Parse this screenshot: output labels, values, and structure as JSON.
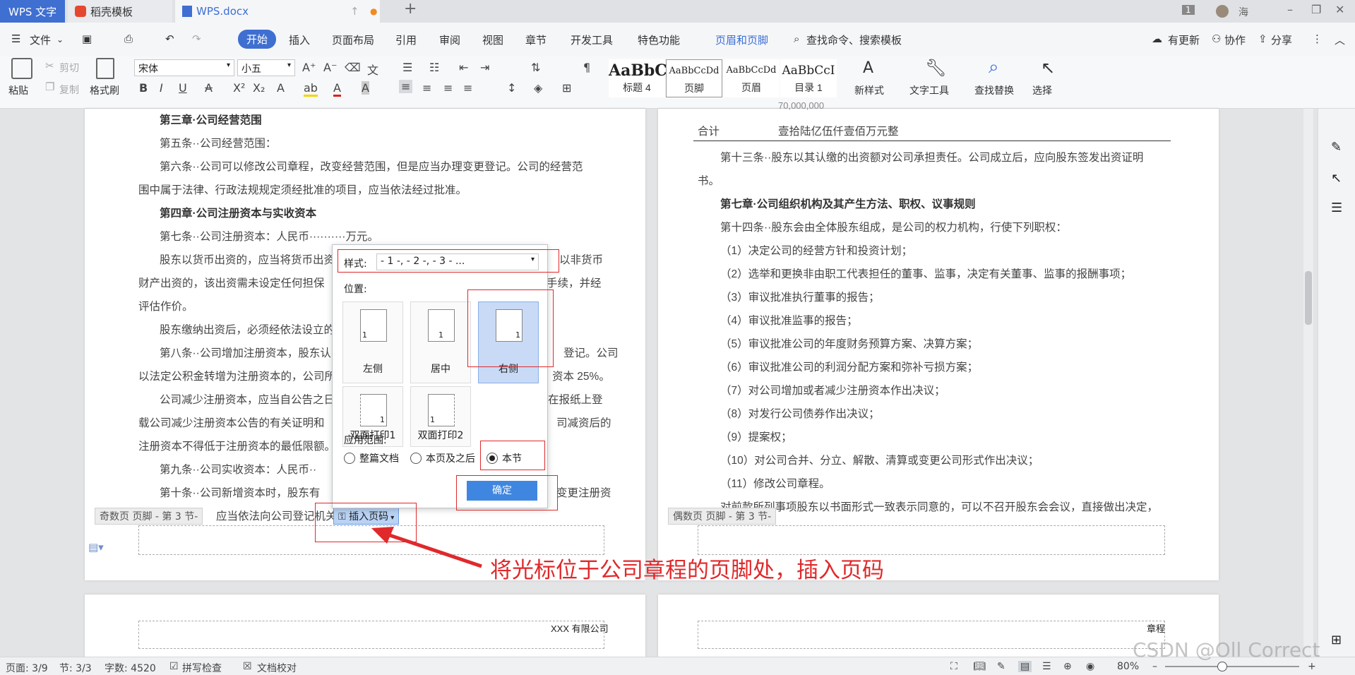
{
  "tabs": {
    "app": "WPS 文字",
    "template": "稻壳模板",
    "doc": "WPS.docx"
  },
  "titlebar": {
    "badge": "1",
    "user": "海"
  },
  "menu": {
    "file": "文件",
    "items": [
      "开始",
      "插入",
      "页面布局",
      "引用",
      "审阅",
      "视图",
      "章节",
      "开发工具",
      "特色功能"
    ],
    "header_footer": "页眉和页脚",
    "search": "查找命令、搜索模板",
    "update": "有更新",
    "collab": "协作",
    "share": "分享"
  },
  "ribbon": {
    "paste": "粘贴",
    "cut": "剪切",
    "copy": "复制",
    "format_painter": "格式刷",
    "font": "宋体",
    "size": "小五",
    "bold": "B",
    "italic": "I",
    "underline": "U",
    "styles": [
      {
        "preview": "AaBbC",
        "label": "标题 4"
      },
      {
        "preview": "AaBbCcDd",
        "label": "页脚"
      },
      {
        "preview": "AaBbCcDd",
        "label": "页眉"
      },
      {
        "preview": "AaBbCcI",
        "label": "目录 1"
      }
    ],
    "new_style": "新样式",
    "text_tools": "文字工具",
    "find_replace": "查找替换",
    "select": "选择"
  },
  "left_page": {
    "lines": [
      "第三章·公司经营范围",
      "第五条··公司经营范围：",
      "第六条··公司可以修改公司章程，改变经营范围，但是应当办理变更登记。公司的经营范",
      "围中属于法律、行政法规规定须经批准的项目，应当依法经过批准。",
      "第四章·公司注册资本与实收资本",
      "第七条··公司注册资本：人民币··········万元。",
      "股东以货币出资的，应当将货币出资",
      "以非货币",
      "财产出资的，该出资需未设定任何担保",
      "手续，并经",
      "评估作价。",
      "股东缴纳出资后，必须经依法设立的",
      "第八条··公司增加注册资本，股东认",
      "登记。公司",
      "以法定公积金转增为注册资本的，公司所",
      "资本 25%。",
      "公司减少注册资本，应当自公告之日",
      "在报纸上登",
      "载公司减少注册资本公告的有关证明和",
      "司减资后的",
      "注册资本不得低于注册资本的最低限额。",
      "第九条··公司实收资本：人民币··",
      "第十条··公司新增资本时，股东有",
      "变更注册资",
      "应当依法向公司登记机关"
    ],
    "footer_tag": "奇数页 页脚  - 第 3 节-",
    "insert_page_btn": "插入页码"
  },
  "right_page": {
    "top_value": "70,000,000",
    "total_label": "合计",
    "total_value": "壹拾陆亿伍仟壹佰万元整",
    "lines": [
      "第十三条··股东以其认缴的出资额对公司承担责任。公司成立后，应向股东签发出资证明",
      "书。",
      "第七章·公司组织机构及其产生方法、职权、议事规则",
      "第十四条··股东会由全体股东组成，是公司的权力机构，行使下列职权：",
      "（1）决定公司的经营方针和投资计划；",
      "（2）选举和更换非由职工代表担任的董事、监事，决定有关董事、监事的报酬事项；",
      "（3）审议批准执行董事的报告；",
      "（4）审议批准监事的报告；",
      "（5）审议批准公司的年度财务预算方案、决算方案；",
      "（6）审议批准公司的利润分配方案和弥补亏损方案；",
      "（7）对公司增加或者减少注册资本作出决议；",
      "（8）对发行公司债券作出决议；",
      "（9）提案权；",
      "（10）对公司合并、分立、解散、清算或变更公司形式作出决议；",
      "（11）修改公司章程。",
      "对前款所列事项股东以书面形式一致表示同意的，可以不召开股东会会议，直接做出决定，"
    ],
    "footer_tag": "偶数页 页脚  - 第 3 节-"
  },
  "next_pages": {
    "left_header": "XXX 有限公司",
    "right_header": "章程"
  },
  "dialog": {
    "style_label": "样式:",
    "style_value": "- 1 -, - 2 -, - 3 - ...",
    "position_label": "位置:",
    "positions": [
      "左侧",
      "居中",
      "右侧",
      "双面打印1",
      "双面打印2"
    ],
    "range_label": "应用范围:",
    "ranges": [
      "整篇文档",
      "本页及之后",
      "本节"
    ],
    "ok": "确定"
  },
  "annotation": "将光标位于公司章程的页脚处，插入页码",
  "status": {
    "page": "页面: 3/9",
    "section": "节: 3/3",
    "words": "字数: 4520",
    "spell": "拼写检查",
    "proof": "文档校对",
    "zoom": "80%"
  },
  "watermark": "CSDN @Oll Correct"
}
